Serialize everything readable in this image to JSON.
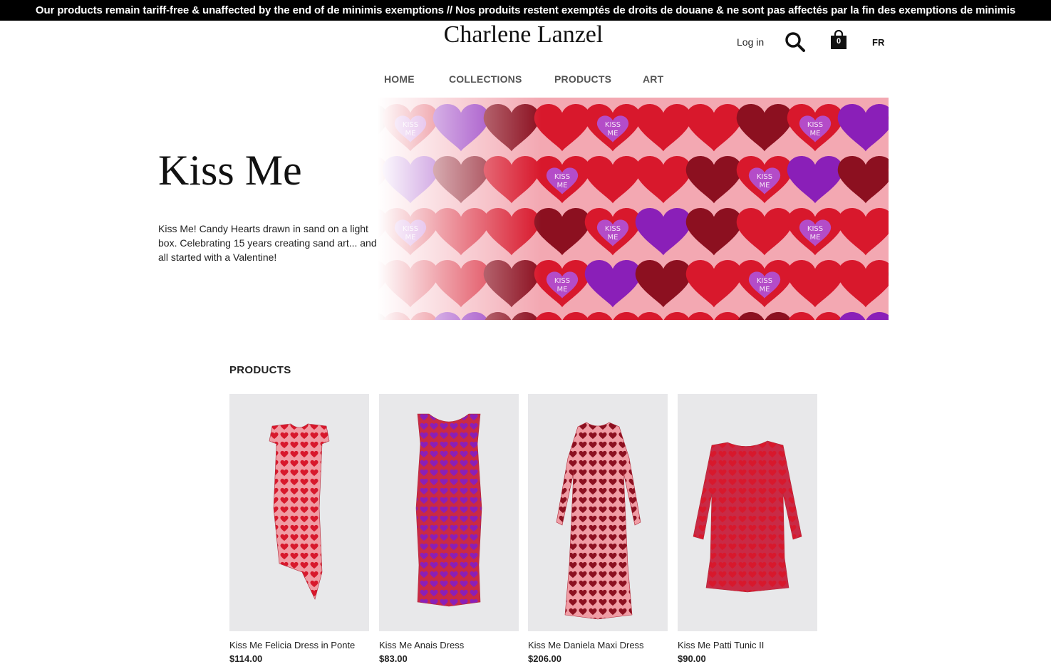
{
  "announcement": "Our products remain tariff-free & unaffected by the end of de minimis exemptions // Nos produits restent exemptés de droits de douane & ne sont pas affectés par la fin des exemptions de minimis",
  "header": {
    "brand": "Charlene Lanzel",
    "login_label": "Log in",
    "search_icon": "search-icon",
    "cart_icon": "shopping-bag-icon",
    "cart_count": "0",
    "language": "FR"
  },
  "nav": {
    "items": [
      {
        "label": "HOME"
      },
      {
        "label": "COLLECTIONS"
      },
      {
        "label": "PRODUCTS"
      },
      {
        "label": "ART"
      }
    ]
  },
  "hero": {
    "title": "Kiss Me",
    "description": "Kiss Me! Candy Hearts drawn in sand on a light box. Celebrating 15 years creating sand art... and it all started with a Valentine!",
    "heart_text": "KISS ME"
  },
  "products": {
    "section_title": "PRODUCTS",
    "items": [
      {
        "name": "Kiss Me Felicia Dress in Ponte",
        "price": "$114.00"
      },
      {
        "name": "Kiss Me Anais Dress",
        "price": "$83.00"
      },
      {
        "name": "Kiss Me Daniela Maxi Dress",
        "price": "$206.00"
      },
      {
        "name": "Kiss Me Patti Tunic II",
        "price": "$90.00"
      }
    ]
  },
  "colors": {
    "announcement_bg": "#000000",
    "heart_red": "#d8182c",
    "heart_purple": "#8a1fb8",
    "heart_dark": "#8c1020",
    "heart_pink_candy": "#b44cc8",
    "banner_bg": "#f3a8b2",
    "product_bg": "#e8e8ea"
  }
}
